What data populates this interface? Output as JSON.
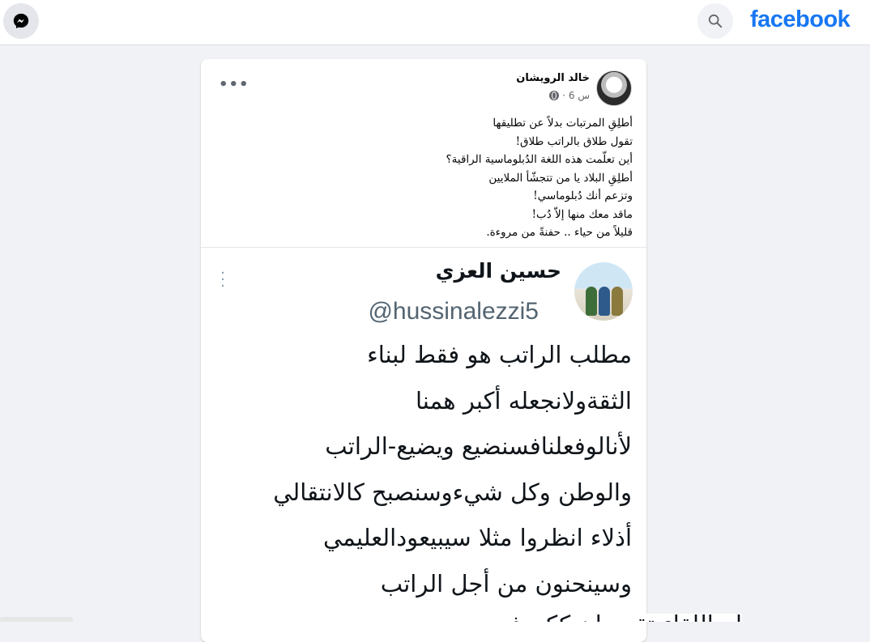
{
  "header": {
    "brand": "facebook",
    "brand_color": "#1877f2",
    "messenger_icon": "messenger-icon",
    "search_icon": "search-icon"
  },
  "post": {
    "author": "خالد الرويشان",
    "time": "6 س",
    "separator": "·",
    "privacy_icon": "globe-icon",
    "more_label": "•••",
    "lines": [
      "أطلِقِ المرتبات بدلاً عن تطليقها",
      "تقول طلاق بالراتب طلاق!",
      "أين تعلّمت هذه اللغة الدُبلوماسية الراقية؟",
      "أطلِقِ البلاد يا من تتجشّأ الملايين",
      "وتزعم أنك دُبلوماسي!",
      "ماقد معك منها إلاّ دُب!",
      "قليلاً من حياء .. حفنةً من مروءة."
    ]
  },
  "tweet": {
    "name": "حسين العزي",
    "handle": "@hussinalezzi5",
    "lines": [
      "مطلب الراتب هو فقط لبناء",
      "الثقةولانجعله أكبر همنا",
      "لأنالوفعلنافسنضيع ويضيع-الراتب",
      "والوطن وكل شيءوسنصبح كالانتقالي",
      "أذلاء انظروا مثلا سيبيعودالعليمي",
      "وسينحنون من أجل الراتب"
    ],
    "partial_line": "أم اللقاء تقدم أن ككروف"
  }
}
